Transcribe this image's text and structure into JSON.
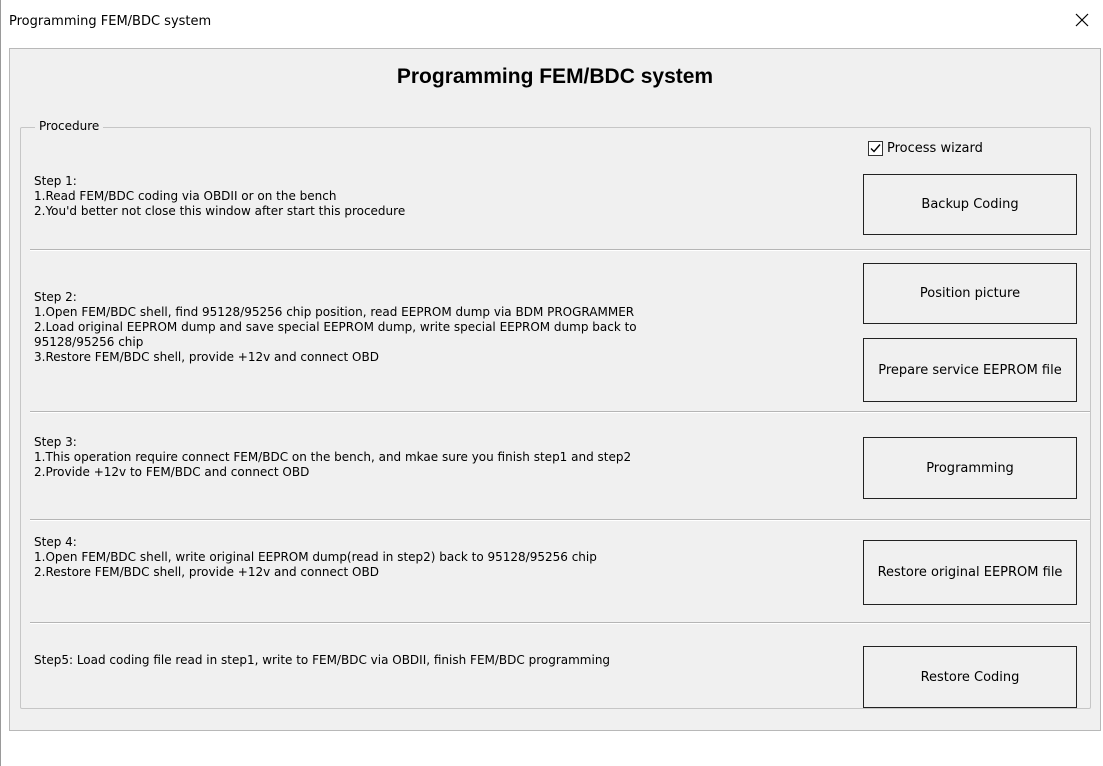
{
  "window": {
    "title": "Programming FEM/BDC system"
  },
  "header": {
    "title": "Programming FEM/BDC system"
  },
  "procedure": {
    "legend": "Procedure",
    "wizard_label": "Process wizard",
    "wizard_checked": true
  },
  "steps": [
    {
      "heading": "Step 1:",
      "lines": [
        "1.Read FEM/BDC coding via OBDII or on the bench",
        "2.You'd better not close this window after start this procedure"
      ]
    },
    {
      "heading": "Step 2:",
      "lines": [
        "1.Open FEM/BDC shell, find 95128/95256 chip position, read EEPROM dump via BDM PROGRAMMER",
        "2.Load original EEPROM dump and save special EEPROM dump, write special EEPROM dump back to",
        "95128/95256 chip",
        "3.Restore FEM/BDC shell, provide +12v and connect OBD"
      ]
    },
    {
      "heading": "Step 3:",
      "lines": [
        "1.This operation require connect FEM/BDC on the bench, and mkae sure you finish step1 and step2",
        "2.Provide +12v to FEM/BDC and connect OBD"
      ]
    },
    {
      "heading": "Step 4:",
      "lines": [
        "1.Open FEM/BDC shell, write original EEPROM dump(read in step2) back to 95128/95256 chip",
        "2.Restore FEM/BDC shell, provide +12v and connect OBD"
      ]
    },
    {
      "heading": "Step5: Load coding file read in step1, write to FEM/BDC via OBDII, finish FEM/BDC programming",
      "lines": []
    }
  ],
  "buttons": {
    "backup_coding": "Backup Coding",
    "position_picture": "Position picture",
    "prepare_eeprom": "Prepare service EEPROM file",
    "programming": "Programming",
    "restore_eeprom": "Restore original EEPROM file",
    "restore_coding": "Restore Coding"
  },
  "icons": {
    "close": "close-icon",
    "check": "checkmark-icon"
  }
}
